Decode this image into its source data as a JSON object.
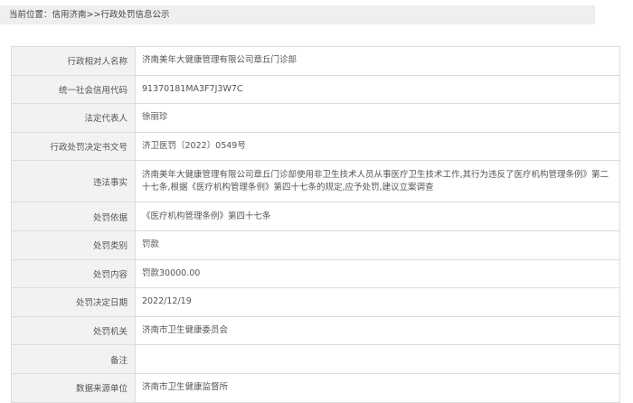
{
  "breadcrumb": {
    "prefix": "当前位置：",
    "home": "信用济南",
    "separator": ">>",
    "current": "行政处罚信息公示"
  },
  "rows": [
    {
      "label": "行政相对人名称",
      "value": "济南美年大健康管理有限公司章丘门诊部"
    },
    {
      "label": "统一社会信用代码",
      "value": "91370181MA3F7J3W7C"
    },
    {
      "label": "法定代表人",
      "value": "徐丽珍"
    },
    {
      "label": "行政处罚决定书文号",
      "value": "济卫医罚〔2022〕0549号"
    },
    {
      "label": "违法事实",
      "value": "济南美年大健康管理有限公司章丘门诊部使用非卫生技术人员从事医疗卫生技术工作,其行为违反了医疗机构管理条例》第二十七条,根据《医疗机构管理条例》第四十七条的规定,应予处罚,建议立案调查"
    },
    {
      "label": "处罚依据",
      "value": "《医疗机构管理条例》第四十七条"
    },
    {
      "label": "处罚类别",
      "value": "罚款"
    },
    {
      "label": "处罚内容",
      "value": "罚款30000.00"
    },
    {
      "label": "处罚决定日期",
      "value": "2022/12/19"
    },
    {
      "label": "处罚机关",
      "value": "济南市卫生健康委员会"
    },
    {
      "label": "备注",
      "value": ""
    },
    {
      "label": "数据来源单位",
      "value": "济南市卫生健康监督所"
    }
  ]
}
